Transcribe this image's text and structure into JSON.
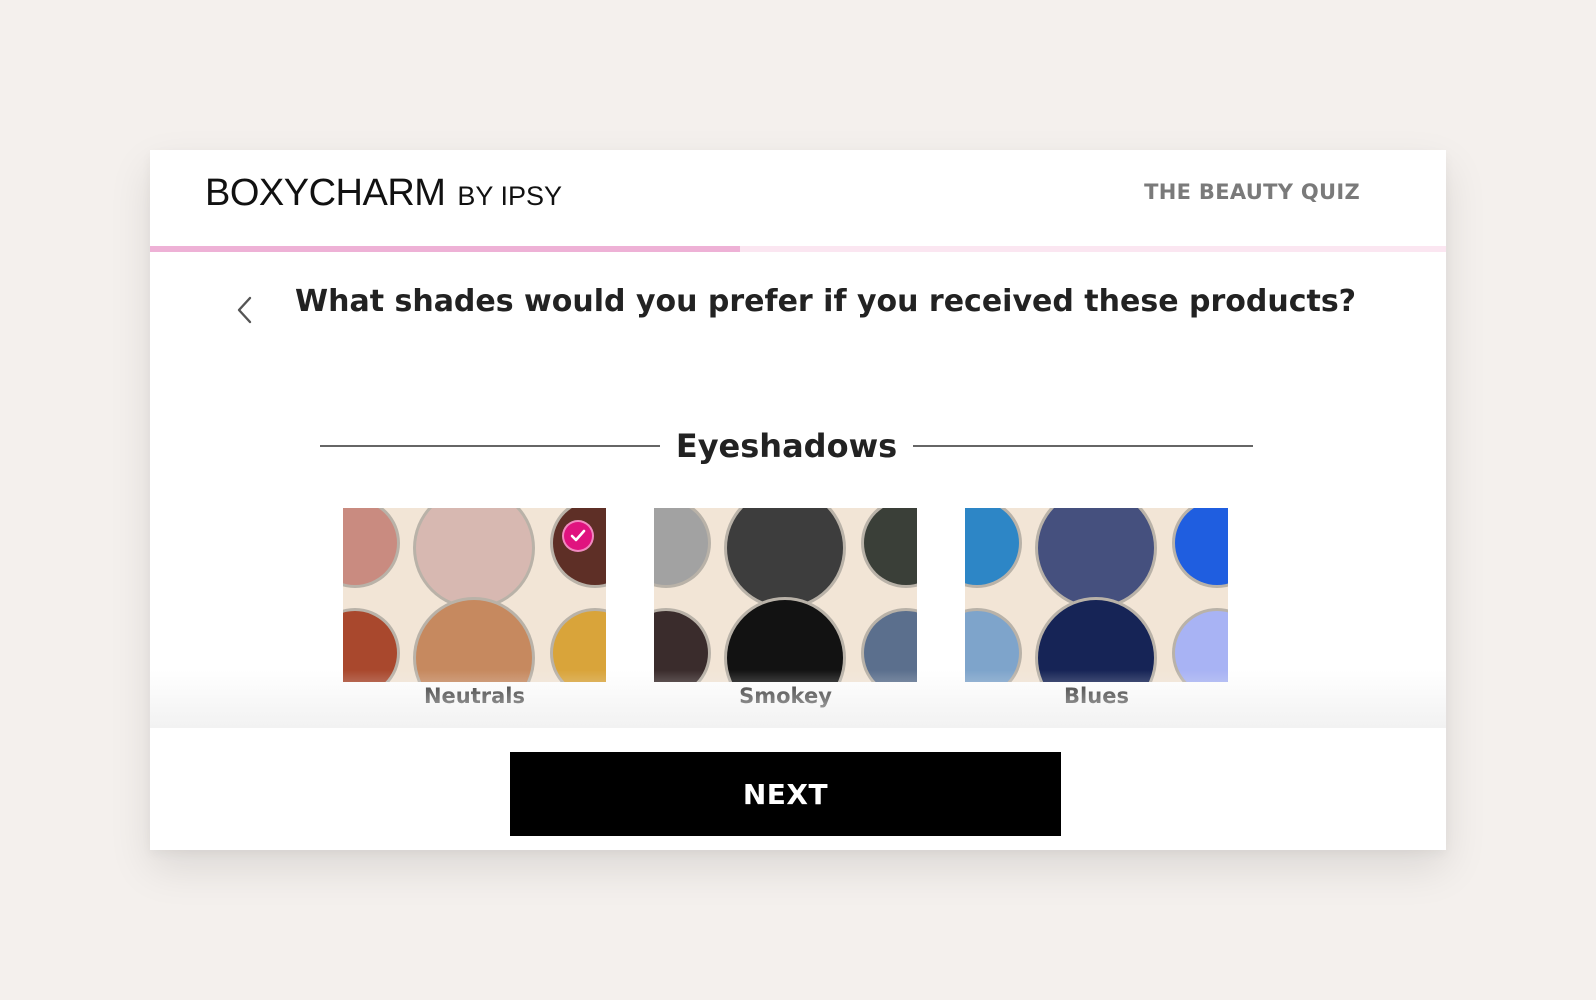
{
  "header": {
    "logo_main": "BOXYCHARM",
    "logo_sub": "BY IPSY",
    "quiz_title": "THE BEAUTY QUIZ"
  },
  "progress": {
    "fraction": 0.455,
    "fill_color": "#eeb1d6",
    "track_color": "#fbe6f1"
  },
  "question": {
    "back_icon": "chevron-left-icon",
    "text": "What shades would you prefer if you received these products?"
  },
  "section": {
    "title": "Eyeshadows"
  },
  "options": [
    {
      "label": "Neutrals",
      "selected": true,
      "shades": [
        "#c98b80",
        "#d7b8b1",
        "#5e2f26",
        "#a9482d",
        "#c6895f",
        "#d9a43a"
      ]
    },
    {
      "label": "Smokey",
      "selected": false,
      "shades": [
        "#a2a2a2",
        "#3d3d3d",
        "#3a3f38",
        "#3a2c2c",
        "#121212",
        "#5b6f8d"
      ]
    },
    {
      "label": "Blues",
      "selected": false,
      "shades": [
        "#2d86c6",
        "#45507e",
        "#1f5ee0",
        "#7ea4cb",
        "#162456",
        "#a8b3f4"
      ]
    }
  ],
  "colors": {
    "accent": "#e0137f",
    "palette_bg": "#f2e5d6",
    "page_bg": "#f4f0ed"
  },
  "footer": {
    "next_label": "NEXT"
  }
}
